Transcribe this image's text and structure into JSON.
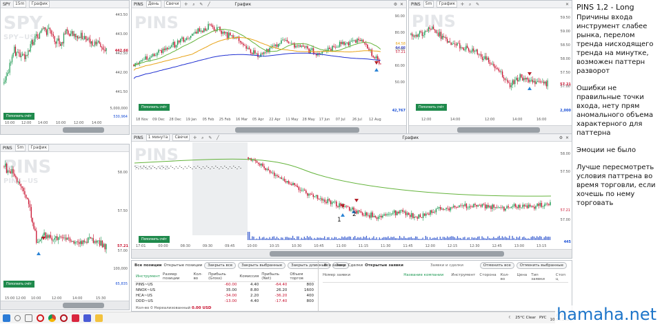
{
  "panels": {
    "spy": {
      "symbol": "SPY",
      "interval": "15m",
      "chart_type": "График",
      "watermark": "SPY",
      "sub": "SPY~US",
      "yticks": [
        "443.50",
        "443.00",
        "442.50",
        "442.00",
        "441.50"
      ],
      "price_badge": "442.66",
      "xticks": [
        "10:00",
        "12:00",
        "14:00",
        "10:00",
        "12:00",
        "14:00"
      ],
      "vol_ticks": [
        "5,000,000",
        "530,964"
      ],
      "deposit": "Пополнить счёт"
    },
    "pins_daily": {
      "symbol": "PINS",
      "interval": "День",
      "chart_type": "Свечи",
      "view": "График",
      "watermark": "PINS",
      "yticks": [
        "90.00",
        "80.00",
        "70.00",
        "60.00",
        "50.00"
      ],
      "price_badges": [
        "64.58",
        "64.88",
        "57.21"
      ],
      "xticks": [
        "18 Nov",
        "09 Dec",
        "28 Dec",
        "19 Jan",
        "05 Feb",
        "25 Feb",
        "16 Mar",
        "05 Apr",
        "22 Apr",
        "11 May",
        "28 May",
        "17 Jun",
        "07 Jul",
        "26 Jul",
        "12 Aug"
      ],
      "vol_tick": "42,767",
      "deposit": "Пополнить счёт"
    },
    "pins_top_right": {
      "symbol": "PINS",
      "interval": "5m",
      "chart_type": "График",
      "watermark": "PINS",
      "yticks": [
        "59.50",
        "59.00",
        "58.50",
        "58.00",
        "57.50",
        "57.00"
      ],
      "price_badge": "57.21",
      "xticks": [
        "12:00",
        "14:00",
        "12:00",
        "14:00",
        "16:00"
      ],
      "vol_tick": "2,000",
      "deposit": "Пополнить счёт"
    },
    "pins_left": {
      "symbol": "PINS",
      "interval": "5m",
      "chart_type": "График",
      "watermark": "PINS",
      "sub": "PINS~US",
      "yticks": [
        "58.00",
        "57.50",
        "57.00"
      ],
      "price_badge": "57.21",
      "xticks": [
        "15:00",
        "12:00",
        "10:00",
        "12:00",
        "14:00",
        "15:30"
      ],
      "vol_ticks": [
        "100,000",
        "65,835"
      ],
      "deposit": "Пополнить счёт"
    },
    "pins_1m": {
      "symbol": "PINS",
      "interval": "1 минута",
      "chart_type": "Свечи",
      "view": "График",
      "watermark": "PINS",
      "sub": "PINS~US",
      "yticks": [
        "58.00",
        "57.50",
        "57.21",
        "57.00"
      ],
      "xticks": [
        "17:01",
        "00:00",
        "08:30",
        "09:30",
        "09:45",
        "10:00",
        "10:15",
        "10:30",
        "10:45",
        "11:00",
        "11:15",
        "11:30",
        "11:45",
        "12:00",
        "12:15",
        "12:30",
        "12:45",
        "13:00",
        "13:15"
      ],
      "marker_labels": [
        "1",
        "2"
      ],
      "vol_tick": "445",
      "deposit": "Пополнить счёт"
    }
  },
  "positions": {
    "tabs": [
      "Все позиции",
      "Открытые позиции"
    ],
    "buttons": [
      "Закрыть все",
      "Закрыть выбранные",
      "Закрыть длинные",
      "Закр"
    ],
    "columns": [
      "Инструмент",
      "Размер позиции",
      "Кол-во",
      "Прибыль (Gross)",
      "Комиссия",
      "Прибыль (Net)",
      "Объем торгов"
    ],
    "rows": [
      {
        "instrument": "PINS~US",
        "size": "",
        "qty": "",
        "gross": "-60.00",
        "fee": "4.40",
        "net": "-64.40",
        "volume": "800"
      },
      {
        "instrument": "NNOX~US",
        "size": "",
        "qty": "",
        "gross": "35.00",
        "fee": "8.80",
        "net": "26.20",
        "volume": "1600"
      },
      {
        "instrument": "HCA~US",
        "size": "",
        "qty": "",
        "gross": "-34.00",
        "fee": "2.20",
        "net": "-36.20",
        "volume": "400"
      },
      {
        "instrument": "DDD~US",
        "size": "",
        "qty": "",
        "gross": "-13.00",
        "fee": "4.40",
        "net": "-17.40",
        "volume": "800"
      }
    ],
    "footer_label": "Кол-во 0  Нереализованный",
    "footer_value": "0.00 USD"
  },
  "orders": {
    "tabs": [
      "Все заявки",
      "Сделки",
      "Открытые заявки"
    ],
    "title": "Заявки и сделки",
    "buttons": [
      "Отменить все",
      "Отменить выбранные"
    ],
    "columns_left": [
      "Номер заявки"
    ],
    "columns_right": [
      "Название компании",
      "Инструмент",
      "Сторона",
      "Кол-во",
      "Цена",
      "Тип заявки",
      "Стоп ц"
    ]
  },
  "notes": {
    "title": "PINS 1,2 - Long",
    "reasons": "Причины входа инструмент слабее рынка, перелом тренда нисходящего тренда на минутке, возможен паттерн разворот",
    "errors": "Ошибки не правильные точки входа, нету прям аномального объема характерного для паттерна",
    "emotions": "Эмоции не было",
    "better": "Лучше пересмотреть условия паттрена во время торговли, если хочешь по нему торговать"
  },
  "taskbar": {
    "weather": "25°C  Clear",
    "lang": "РУС",
    "time": "22:37",
    "date": "10.08.2021"
  },
  "watermark_site": "hamaha.net",
  "colors": {
    "up": "#1a9850",
    "down": "#c8102e",
    "ma_fast": "#63b33a",
    "ma_mid": "#e8a317",
    "ma_slow": "#1f2fd1",
    "deposit": "#1f8a4c"
  }
}
